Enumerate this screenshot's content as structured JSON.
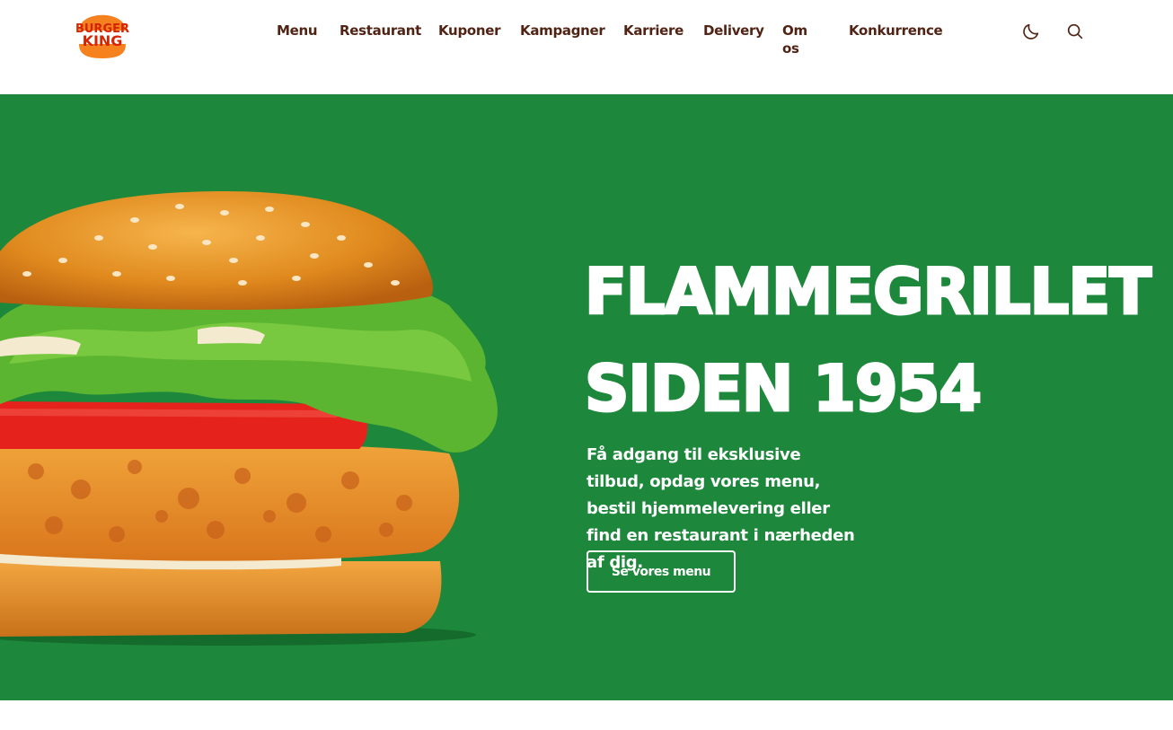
{
  "colors": {
    "hero_bg": "#1d883b",
    "nav_text": "#502314",
    "logo_bun": "#f5821f",
    "logo_text": "#d62300",
    "white": "#ffffff"
  },
  "logo": {
    "line1": "BURGER",
    "line2": "KING"
  },
  "nav": {
    "items": [
      {
        "label": "Menu"
      },
      {
        "label": "Restaurant"
      },
      {
        "label": "Kuponer"
      },
      {
        "label": "Kampagner"
      },
      {
        "label": "Karriere"
      },
      {
        "label": "Delivery"
      },
      {
        "label": "Om os"
      },
      {
        "label": "Konkurrence"
      }
    ]
  },
  "icons": {
    "theme": "moon-icon",
    "search": "search-icon"
  },
  "hero": {
    "headline_line1": "FLAMMEGRILLET",
    "headline_line2": "SIDEN 1954",
    "description": "Få adgang til eksklusive tilbud, opdag vores menu, bestil hjemmelevering eller find en restaurant i nærheden af dig.",
    "cta_label": "Se vores menu"
  }
}
